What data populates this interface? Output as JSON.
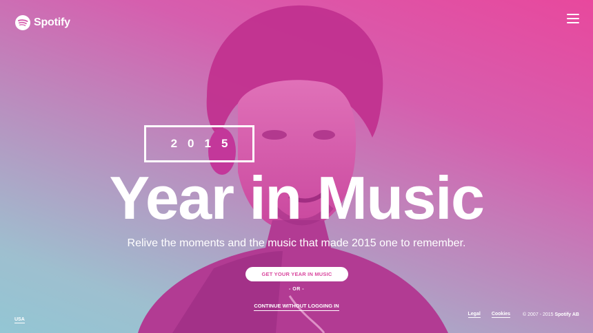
{
  "brand": {
    "name": "Spotify"
  },
  "hero": {
    "year": "2015",
    "headline": "Year in Music",
    "subtitle": "Relive the moments and the music that made 2015 one to remember."
  },
  "actions": {
    "cta_label": "GET YOUR YEAR IN MUSIC",
    "or_label": "- OR -",
    "continue_label": "CONTINUE WITHOUT LOGGING IN"
  },
  "footer": {
    "region": "USA",
    "legal": "Legal",
    "cookies": "Cookies",
    "copyright": "© 2007 - 2015",
    "company": "Spotify AB"
  },
  "colors": {
    "accent_pink": "#e8489d",
    "gradient_teal": "#93c6d4",
    "cta_text": "#d9479e"
  },
  "icons": {
    "logo": "spotify-logo-icon",
    "menu": "hamburger-menu-icon"
  }
}
